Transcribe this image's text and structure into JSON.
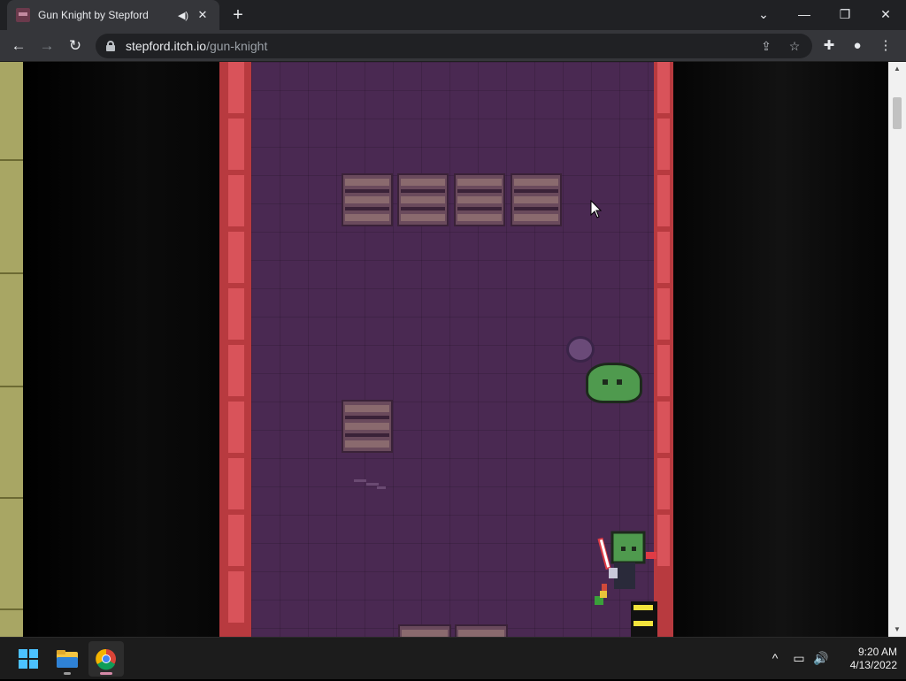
{
  "browser": {
    "tab": {
      "title": "Gun Knight by Stepford",
      "audio_icon": "speaker-muted-icon",
      "close_icon": "close-icon"
    },
    "new_tab_label": "+",
    "window_controls": {
      "tab_search": "⌄",
      "minimize": "—",
      "restore": "❐",
      "close": "✕"
    },
    "nav": {
      "back": "←",
      "forward": "→",
      "reload": "↻"
    },
    "address": {
      "host": "stepford.itch.io",
      "path": "/gun-knight"
    },
    "toolbar_icons": {
      "share": "⇪",
      "bookmark": "☆",
      "extensions": "✚",
      "profile": "●",
      "menu": "⋮"
    }
  },
  "taskbar": {
    "apps": [
      "start-icon",
      "file-explorer-icon",
      "chrome-icon"
    ],
    "tray": {
      "chevron": "^",
      "network": "▭",
      "volume": "🔊"
    },
    "clock": {
      "time": "9:20 AM",
      "date": "4/13/2022"
    }
  },
  "colors": {
    "game_floor": "#4a2952",
    "wall": "#b83a3f",
    "slime": "#4f9a4e",
    "hud_bar": "#f3e33c"
  }
}
